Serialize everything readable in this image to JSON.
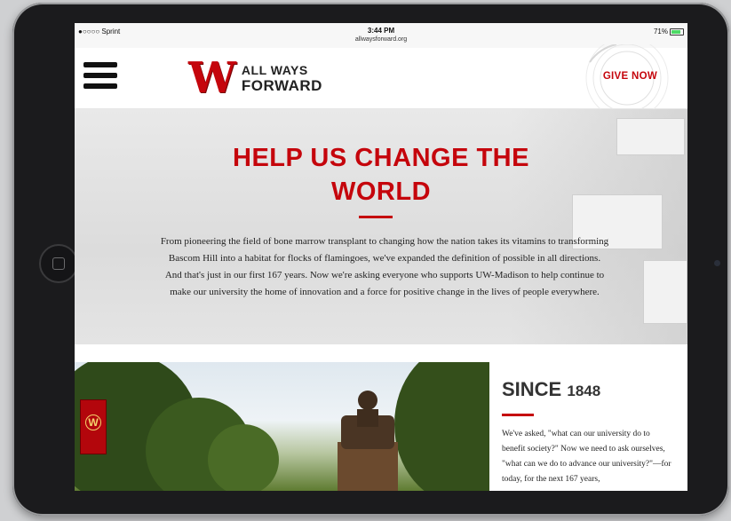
{
  "status_bar": {
    "carrier": "●○○○○ Sprint",
    "time": "3:44 PM",
    "url": "allwaysforward.org",
    "battery": "71%"
  },
  "header": {
    "logo_letter": "W",
    "logo_line1": "ALL WAYS",
    "logo_line2": "FORWARD",
    "give_label": "GIVE NOW"
  },
  "hero": {
    "title_line1": "HELP US CHANGE THE",
    "title_line2": "WORLD",
    "body": "From pioneering the field of bone marrow transplant to changing how the nation takes its vitamins to transforming Bascom Hill into a habitat for flocks of flamingoes, we've expanded the definition of possible in all directions. And that's just in our first 167 years. Now we're asking everyone who supports UW-Madison to help continue to make our university the home of innovation and a force for positive change in the lives of people everywhere."
  },
  "since_section": {
    "title": "SINCE",
    "year": "1848",
    "body": "We've asked, \"what can our university do to benefit society?\" Now we need to ask ourselves, \"what can we do to advance our university?\"—for today, for the next 167 years,"
  },
  "photo": {
    "banner_letter": "W"
  },
  "colors": {
    "brand_red": "#c5050c",
    "battery_green": "#4cd964"
  }
}
